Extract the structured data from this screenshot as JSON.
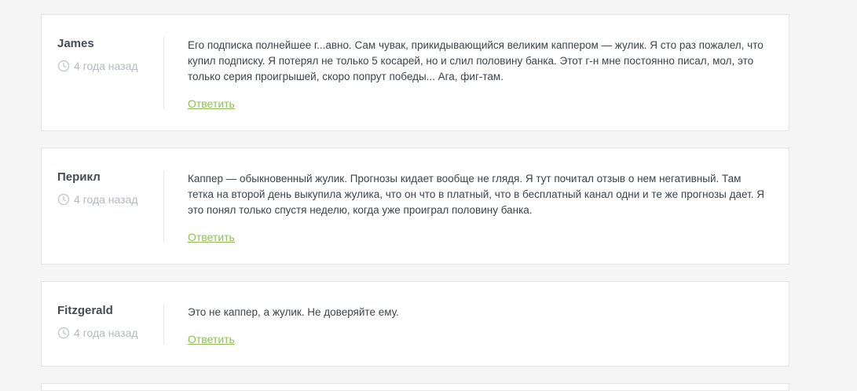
{
  "comments": [
    {
      "author": "James",
      "time": "4 года назад",
      "text": "Его подписка полнейшее г...авно. Сам чувак, прикидывающийся великим каппером — жулик. Я сто раз пожалел, что купил подписку. Я потерял не только 5 косарей, но и слил половину банка. Этот г-н мне постоянно писал, мол, это только серия проигрышей, скоро попрут победы... Ага, фиг-там.",
      "reply_label": "Ответить"
    },
    {
      "author": "Перикл",
      "time": "4 года назад",
      "text": "Каппер — обыкновенный жулик. Прогнозы кидает вообще не глядя. Я тут почитал отзыв о нем негативный. Там тетка на второй день выкупила жулика, что он что в платный, что в бесплатный канал одни и те же прогнозы дает. Я это понял только спустя неделю, когда уже проиграл половину банка.",
      "reply_label": "Ответить"
    },
    {
      "author": "Fitzgerald",
      "time": "4 года назад",
      "text": "Это не каппер, а жулик. Не доверяйте ему.",
      "reply_label": "Ответить"
    }
  ],
  "colors": {
    "background": "#f5f5f5",
    "card": "#ffffff",
    "author": "#444b52",
    "meta": "#b4b8bd",
    "reply_link": "#8cc152"
  },
  "icons": {
    "time": "clock-icon"
  }
}
